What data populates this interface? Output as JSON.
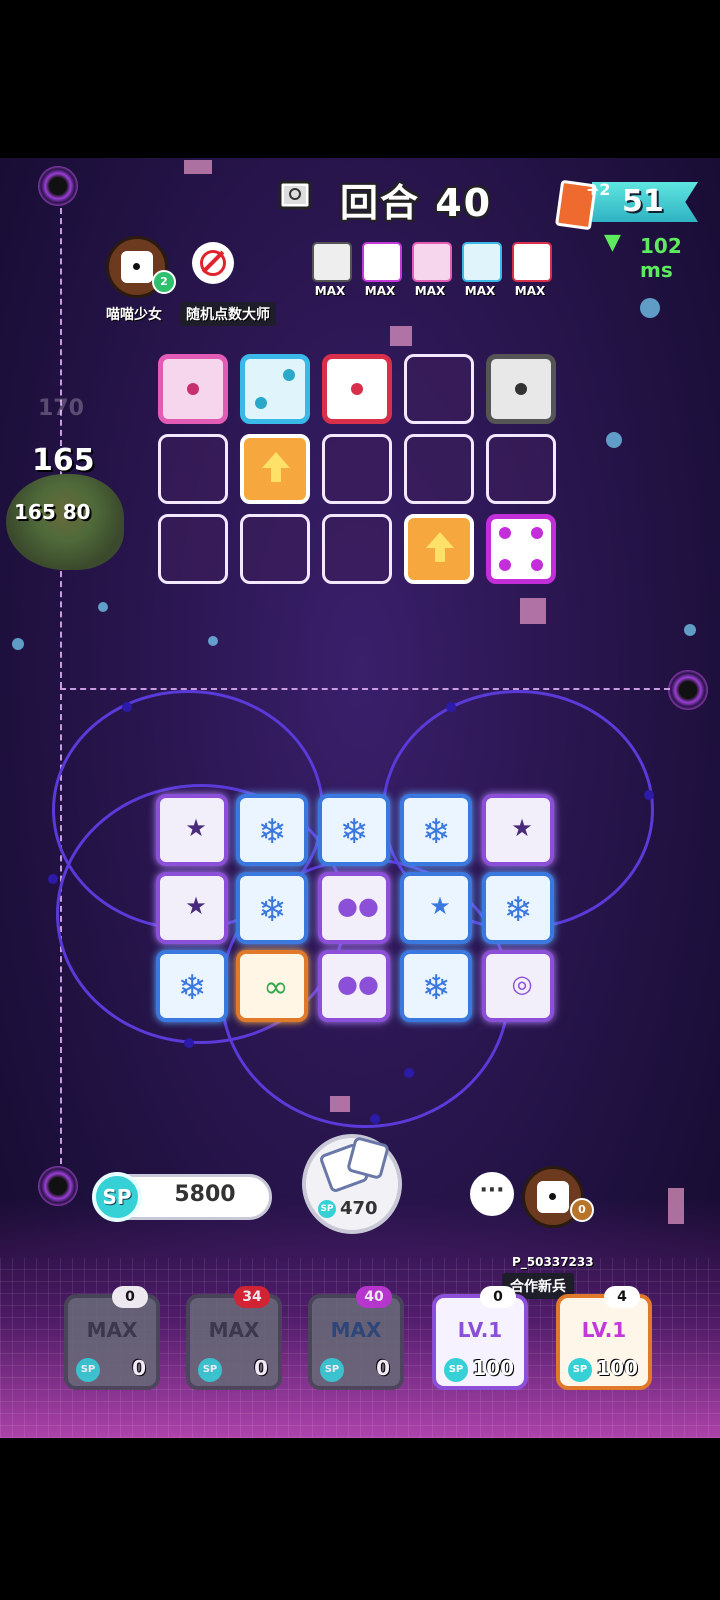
{
  "header": {
    "round_label": "回合 40",
    "card_plus": "+2",
    "card_count": "51",
    "ping": "102 ms"
  },
  "opponent": {
    "name": "喵喵少女",
    "title": "随机点数大师",
    "badge_rank": "2",
    "deck_labels": [
      "MAX",
      "MAX",
      "MAX",
      "MAX",
      "MAX"
    ]
  },
  "boss": {
    "faded_number": "170",
    "count": "165",
    "hp": "165 80"
  },
  "player": {
    "sp_label": "SP",
    "sp_value": "5800",
    "roll_cost": "470",
    "name": "P_50337233",
    "tag": "合作新兵",
    "chat": "···",
    "badge_rank": "0"
  },
  "deck": [
    {
      "level": "MAX",
      "cost": "0",
      "badge": "0"
    },
    {
      "level": "MAX",
      "cost": "0",
      "badge": "34"
    },
    {
      "level": "MAX",
      "cost": "0",
      "badge": "40"
    },
    {
      "level": "LV.1",
      "cost": "100",
      "badge": "0"
    },
    {
      "level": "LV.1",
      "cost": "100",
      "badge": "4"
    }
  ],
  "colors": {
    "accent_cyan": "#35d1d6",
    "ping_green": "#5eea5e",
    "card_orange": "#ef6a2e"
  }
}
